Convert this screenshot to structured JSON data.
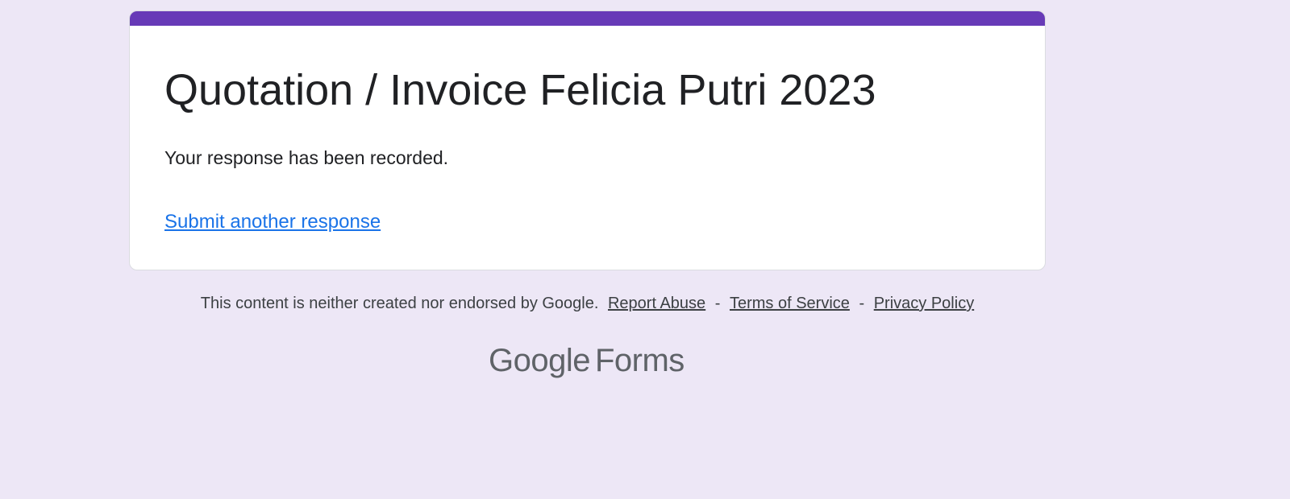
{
  "theme": {
    "background": "#ede7f6",
    "accent": "#673ab7",
    "link": "#1a73e8",
    "card": "#ffffff"
  },
  "form": {
    "title": "Quotation / Invoice Felicia Putri 2023",
    "confirmation": "Your response has been recorded.",
    "submit_another_label": "Submit another response"
  },
  "footer": {
    "disclaimer": "This content is neither created nor endorsed by Google.",
    "report_abuse": "Report Abuse",
    "separator": "-",
    "terms": "Terms of Service",
    "privacy": "Privacy Policy"
  },
  "brand": {
    "logo_text": "Google",
    "product": "Forms"
  }
}
